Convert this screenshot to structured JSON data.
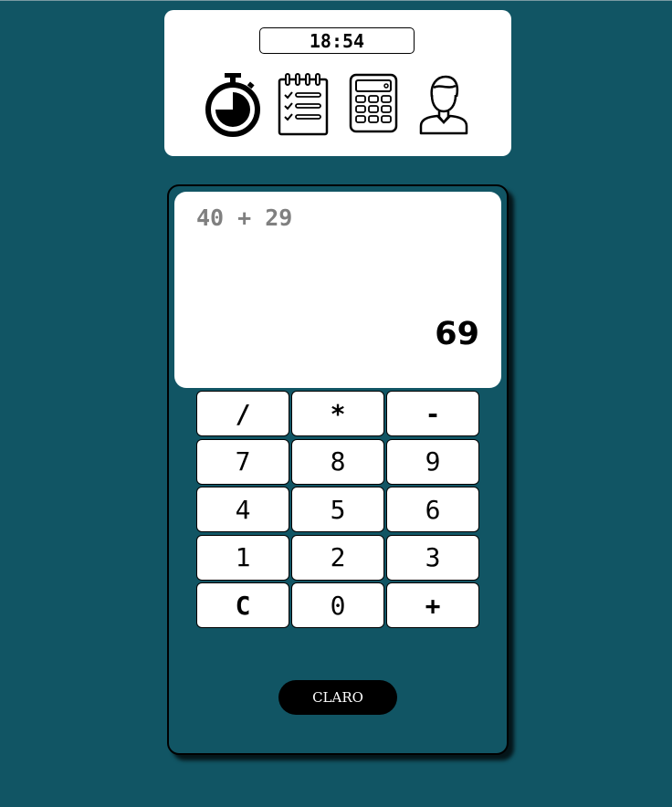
{
  "header": {
    "clock": "18:54",
    "nav_icons": [
      "stopwatch-icon",
      "checklist-icon",
      "calculator-icon",
      "user-icon"
    ]
  },
  "calculator": {
    "expression": "40 + 29",
    "result": "69",
    "keys": [
      "/",
      "*",
      "-",
      "7",
      "8",
      "9",
      "4",
      "5",
      "6",
      "1",
      "2",
      "3",
      "C",
      "0",
      "+"
    ],
    "theme_button": "CLARO"
  },
  "colors": {
    "background": "#115564",
    "card": "#ffffff",
    "expression_text": "#808080",
    "theme_button_bg": "#000000"
  }
}
